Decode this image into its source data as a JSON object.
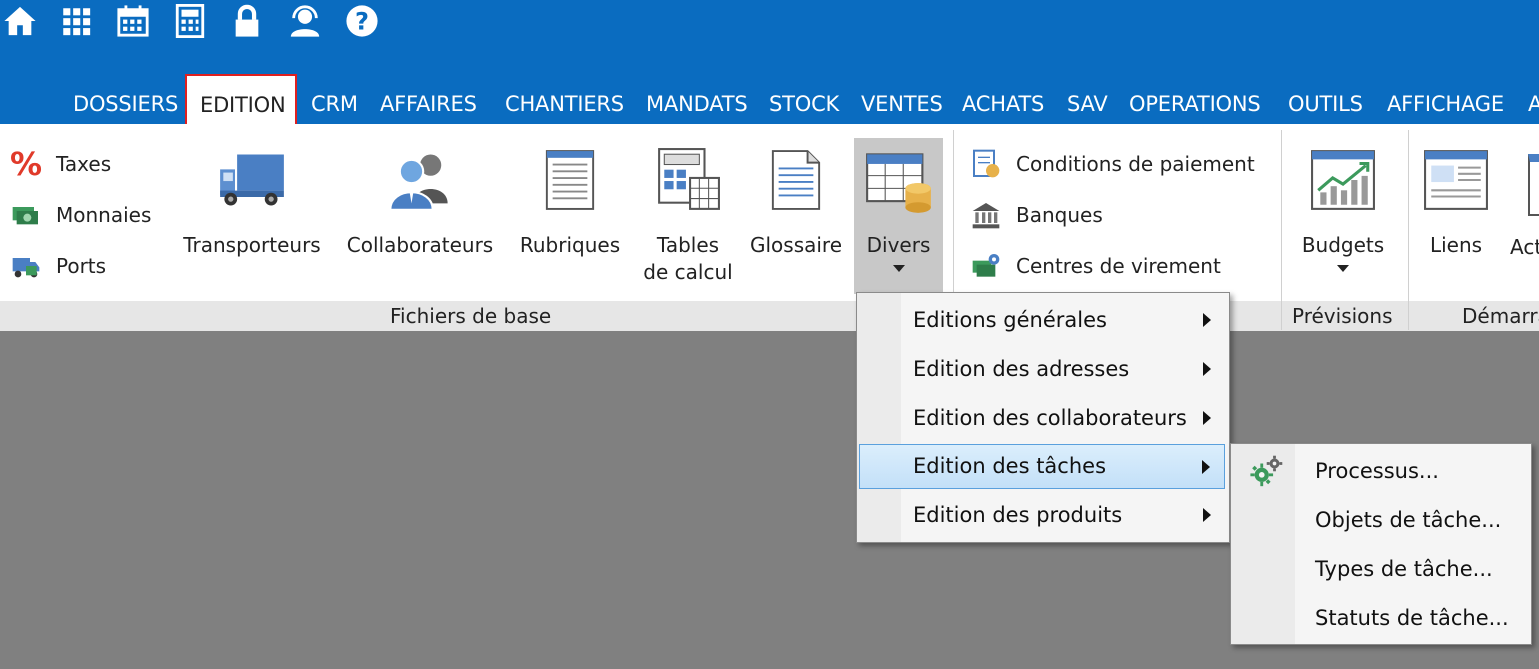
{
  "quick_access": [
    {
      "name": "home-icon"
    },
    {
      "name": "apps-grid-icon"
    },
    {
      "name": "calendar-icon"
    },
    {
      "name": "calculator-icon"
    },
    {
      "name": "lock-icon"
    },
    {
      "name": "support-agent-icon"
    },
    {
      "name": "help-icon"
    }
  ],
  "menu": {
    "tabs": [
      "DOSSIERS",
      "EDITION",
      "CRM",
      "AFFAIRES",
      "CHANTIERS",
      "MANDATS",
      "STOCK",
      "VENTES",
      "ACHATS",
      "SAV",
      "OPERATIONS",
      "OUTILS",
      "AFFICHAGE",
      "A"
    ],
    "active": "EDITION"
  },
  "ribbon": {
    "fichiers": {
      "small": [
        "Taxes",
        "Monnaies",
        "Ports"
      ],
      "big": [
        {
          "line1": "Transporteurs"
        },
        {
          "line1": "Collaborateurs"
        },
        {
          "line1": "Rubriques"
        },
        {
          "line1": "Tables",
          "line2": "de calcul"
        },
        {
          "line1": "Glossaire"
        },
        {
          "line1": "Divers"
        }
      ],
      "group_label": "Fichiers de base"
    },
    "misc_small": [
      "Conditions de paiement",
      "Banques",
      "Centres de virement"
    ],
    "previsions": {
      "button": "Budgets",
      "group_label": "Prévisions"
    },
    "demarrage": {
      "buttons": [
        "Liens",
        "Act"
      ],
      "group_label": "Démarra"
    }
  },
  "divers_menu": {
    "items": [
      "Editions générales",
      "Edition des adresses",
      "Edition des collaborateurs",
      "Edition des tâches",
      "Edition des produits"
    ],
    "highlighted": "Edition des tâches"
  },
  "taches_submenu": {
    "items": [
      "Processus...",
      "Objets de tâche...",
      "Types de tâche...",
      "Statuts de tâche..."
    ]
  },
  "colors": {
    "title_bar": "#0a6cc0",
    "active_tab_border": "#e02020",
    "highlight": "#c3e0f8"
  }
}
